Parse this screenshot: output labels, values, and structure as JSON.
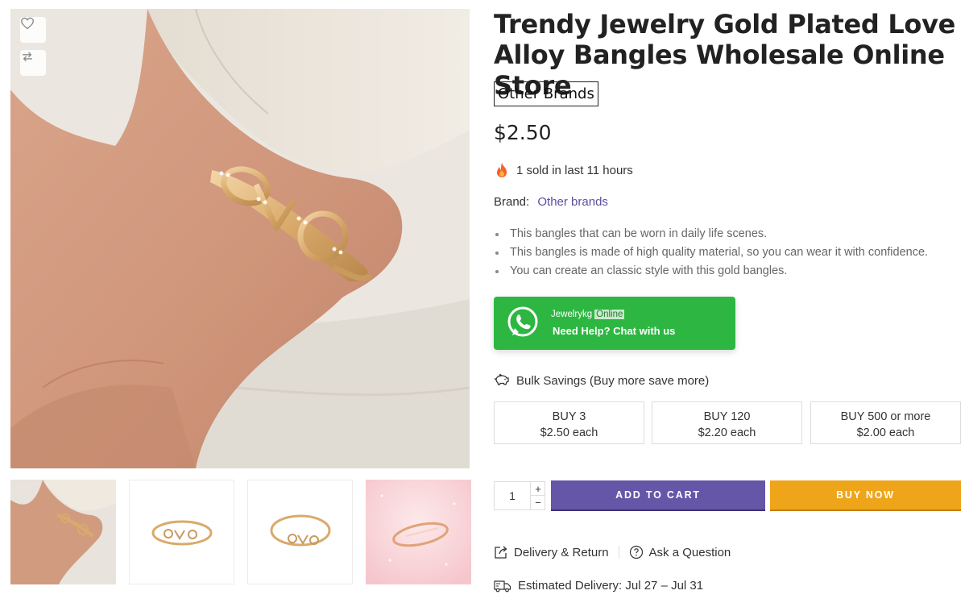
{
  "gallery": {
    "main_alt": "Gold plated LOVE alloy bangle worn on wrist",
    "thumbnails": [
      {
        "name": "thumb-wrist"
      },
      {
        "name": "thumb-white-1"
      },
      {
        "name": "thumb-white-2"
      },
      {
        "name": "thumb-pink"
      }
    ],
    "wishlist_icon": "heart-icon",
    "compare_icon": "compare-icon"
  },
  "product": {
    "title": "Trendy Jewelry Gold Plated Love Alloy Bangles Wholesale Online Store",
    "brand_badge": "Other Brands",
    "price": "$2.50",
    "sold_text": "1 sold in last 11 hours",
    "brand_label": "Brand:",
    "brand_value": "Other brands",
    "bullets": [
      "This bangles that can be worn in daily life scenes.",
      "This bangles is made of high quality material, so you can wear it with confidence.",
      "You can create an classic style with this gold bangles."
    ]
  },
  "whatsapp": {
    "name": "Jewelrykg",
    "status": "Online",
    "help": "Need Help? Chat with us",
    "color": "#2db742"
  },
  "bulk": {
    "heading": "Bulk Savings (Buy more save more)",
    "tiers": [
      {
        "qty": "BUY 3",
        "price": "$2.50 each"
      },
      {
        "qty": "BUY 120",
        "price": "$2.20 each"
      },
      {
        "qty": "BUY 500 or more",
        "price": "$2.00 each"
      }
    ]
  },
  "purchase": {
    "quantity": "1",
    "plus": "+",
    "minus": "−",
    "add_to_cart": "ADD TO CART",
    "buy_now": "BUY NOW",
    "cart_color": "#6656a8",
    "buy_color": "#efa51a"
  },
  "footer_links": {
    "delivery_return": "Delivery & Return",
    "ask_question": "Ask a Question",
    "estimated_delivery": "Estimated Delivery: Jul 27 – Jul 31"
  }
}
